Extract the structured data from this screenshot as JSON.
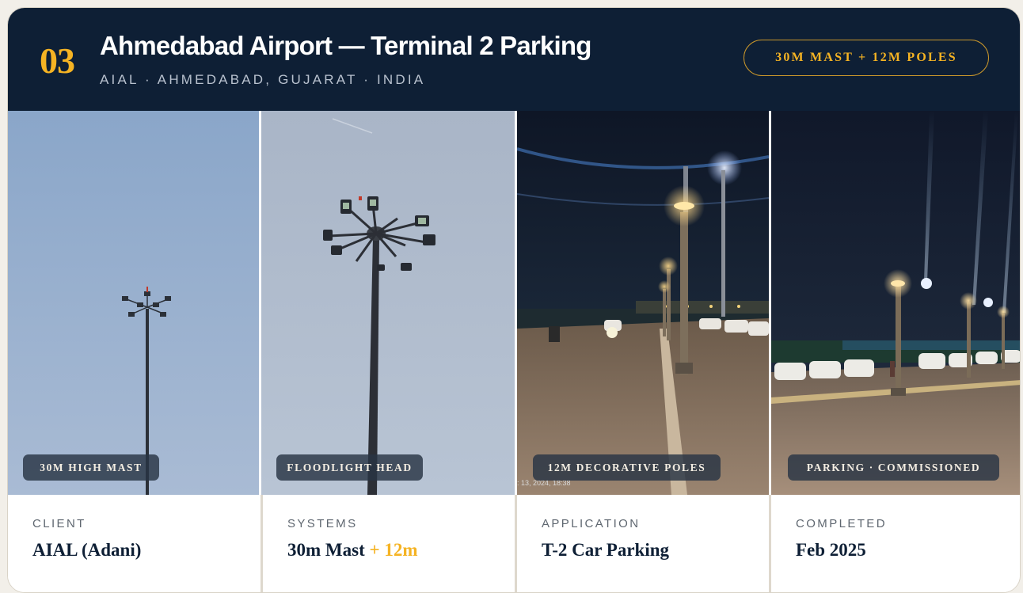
{
  "header": {
    "number": "03",
    "title": "Ahmedabad Airport — Terminal 2 Parking",
    "subtitle": "AIAL · AHMEDABAD, GUJARAT · INDIA",
    "badge": "30M MAST + 12M POLES"
  },
  "photos": [
    {
      "label": "30M HIGH MAST"
    },
    {
      "label": "FLOODLIGHT HEAD"
    },
    {
      "label": "12M DECORATIVE POLES",
      "stamp": ": 13, 2024, 18:38"
    },
    {
      "label": "PARKING · COMMISSIONED"
    }
  ],
  "details": [
    {
      "label": "CLIENT",
      "value": "AIAL (Adani)"
    },
    {
      "label": "SYSTEMS",
      "value": "30m Mast",
      "value_accent": "+ 12m"
    },
    {
      "label": "APPLICATION",
      "value": "T-2 Car Parking"
    },
    {
      "label": "COMPLETED",
      "value": "Feb 2025"
    }
  ],
  "colors": {
    "navy": "#0e1f35",
    "gold": "#f5b323"
  }
}
